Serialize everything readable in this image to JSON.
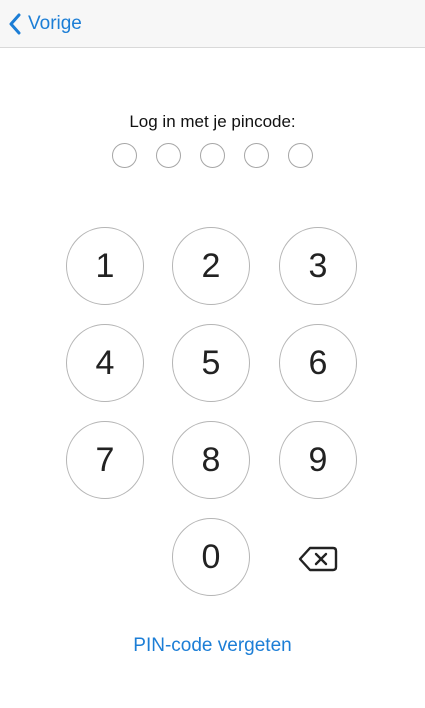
{
  "navbar": {
    "back_label": "Vorige",
    "back_icon": "chevron-left-icon",
    "accent_color": "#1c7ed6"
  },
  "login": {
    "prompt": "Log in met je pincode:",
    "pin_length": 5,
    "digits_entered": 0
  },
  "keypad": {
    "keys": [
      "1",
      "2",
      "3",
      "4",
      "5",
      "6",
      "7",
      "8",
      "9",
      "0"
    ],
    "delete_icon": "backspace-icon"
  },
  "footer": {
    "forgot_label": "PIN-code vergeten"
  }
}
